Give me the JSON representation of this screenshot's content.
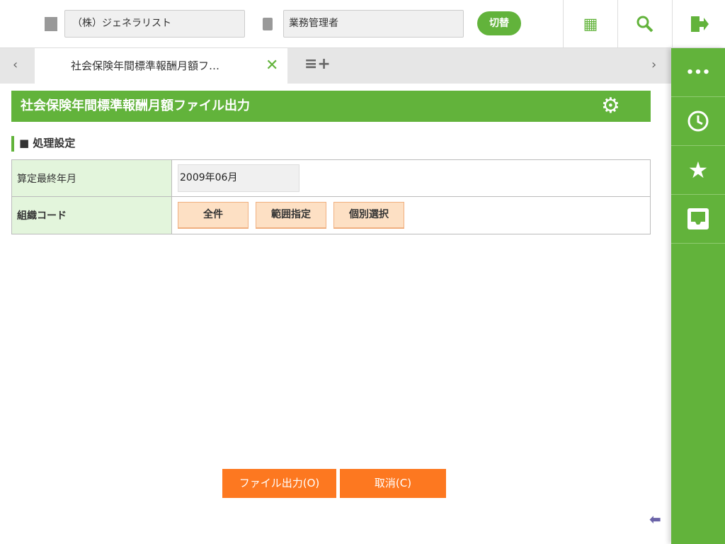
{
  "header": {
    "company": "（株）ジェネラリスト",
    "role": "業務管理者",
    "switch_label": "切替"
  },
  "tabs": {
    "active_label": "社会保険年間標準報酬月額フ…"
  },
  "page": {
    "title": "社会保険年間標準報酬月額ファイル出力",
    "section": "処理設定",
    "rows": [
      {
        "label": "算定最終年月",
        "value": "2009年06月"
      },
      {
        "label": "組織コード",
        "buttons": [
          "全件",
          "範囲指定",
          "個別選択"
        ]
      }
    ]
  },
  "footer": {
    "output_label": "ファイル出力(O)",
    "cancel_label": "取消(C)"
  },
  "colors": {
    "accent": "#62b33b",
    "orange": "#fd7820"
  }
}
